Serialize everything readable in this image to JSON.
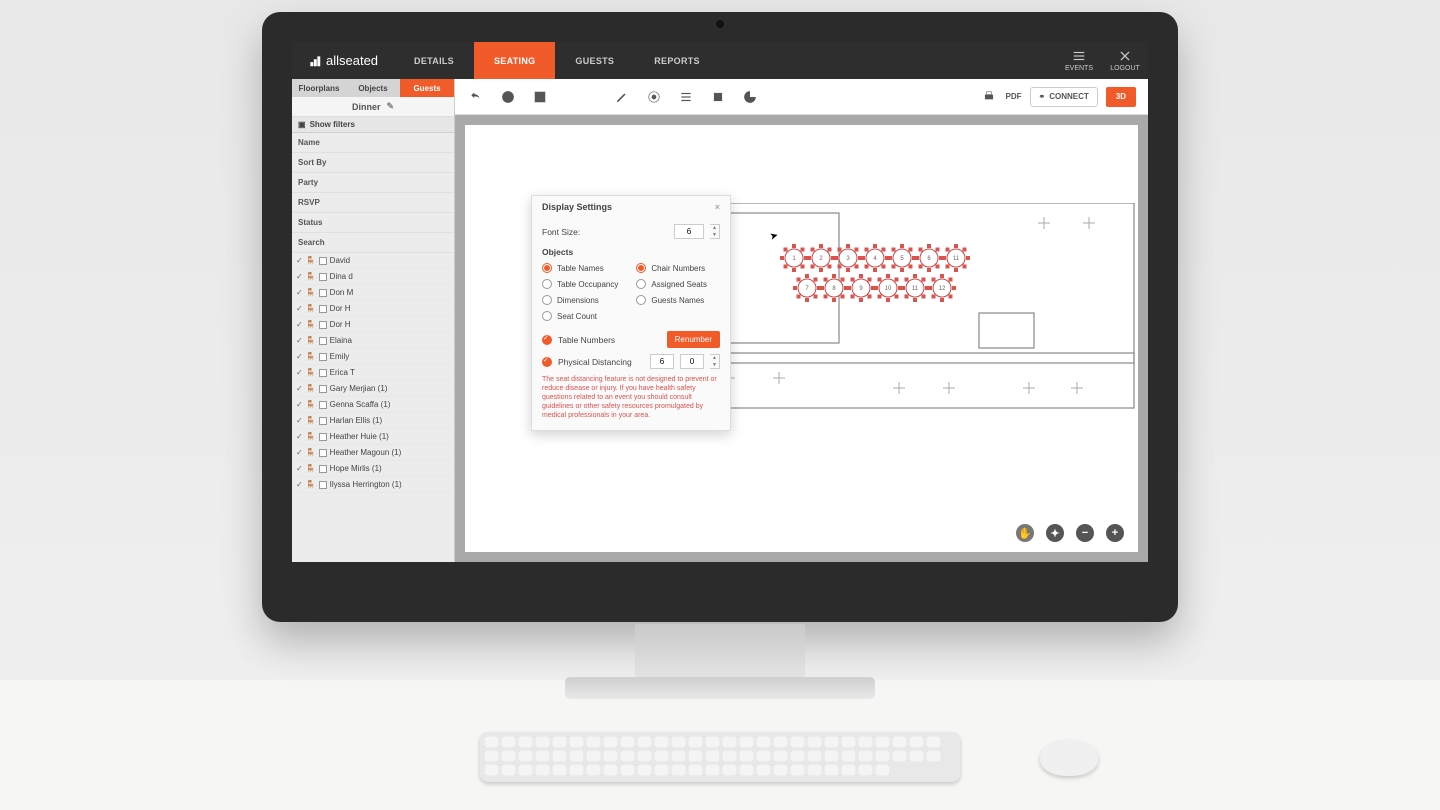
{
  "logo": "allseated",
  "nav": {
    "details": "DETAILS",
    "seating": "SEATING",
    "guests": "GUESTS",
    "reports": "REPORTS",
    "events": "EVENTS",
    "logout": "LOGOUT"
  },
  "sidetabs": {
    "floorplans": "Floorplans",
    "objects": "Objects",
    "guests": "Guests"
  },
  "event_title": "Dinner",
  "show_filters": "Show filters",
  "filters": {
    "name": "Name",
    "sortby": "Sort By",
    "party": "Party",
    "rsvp": "RSVP",
    "status": "Status",
    "search": "Search"
  },
  "guests": [
    "David",
    "Dina d",
    "Don M",
    "Dor H",
    "Dor H",
    "Elaina",
    "Emily",
    "Erica T",
    "Gary Merjian (1)",
    "Genna Scaffa (1)",
    "Harlan Ellis (1)",
    "Heather Huie (1)",
    "Heather Magoun (1)",
    "Hope Mirlis (1)",
    "Ilyssa Herrington (1)"
  ],
  "toolbar_right": {
    "pdf": "PDF",
    "connect": "CONNECT",
    "btn3d": "3D"
  },
  "popup": {
    "title": "Display Settings",
    "font_label": "Font Size:",
    "font_value": "6",
    "objects_head": "Objects",
    "opts": {
      "table_names": "Table Names",
      "table_occupancy": "Table Occupancy",
      "dimensions": "Dimensions",
      "seat_count": "Seat Count",
      "chair_numbers": "Chair Numbers",
      "assigned_seats": "Assigned Seats",
      "guests_names": "Guests Names"
    },
    "table_numbers": "Table Numbers",
    "renumber": "Renumber",
    "physical": "Physical Distancing",
    "dist1": "6",
    "dist2": "0",
    "warn": "The seat distancing feature is not designed to prevent or reduce disease or injury. If you have health safety questions related to an event you should consult guidelines or other safety resources promulgated by medical professionals in your area."
  }
}
